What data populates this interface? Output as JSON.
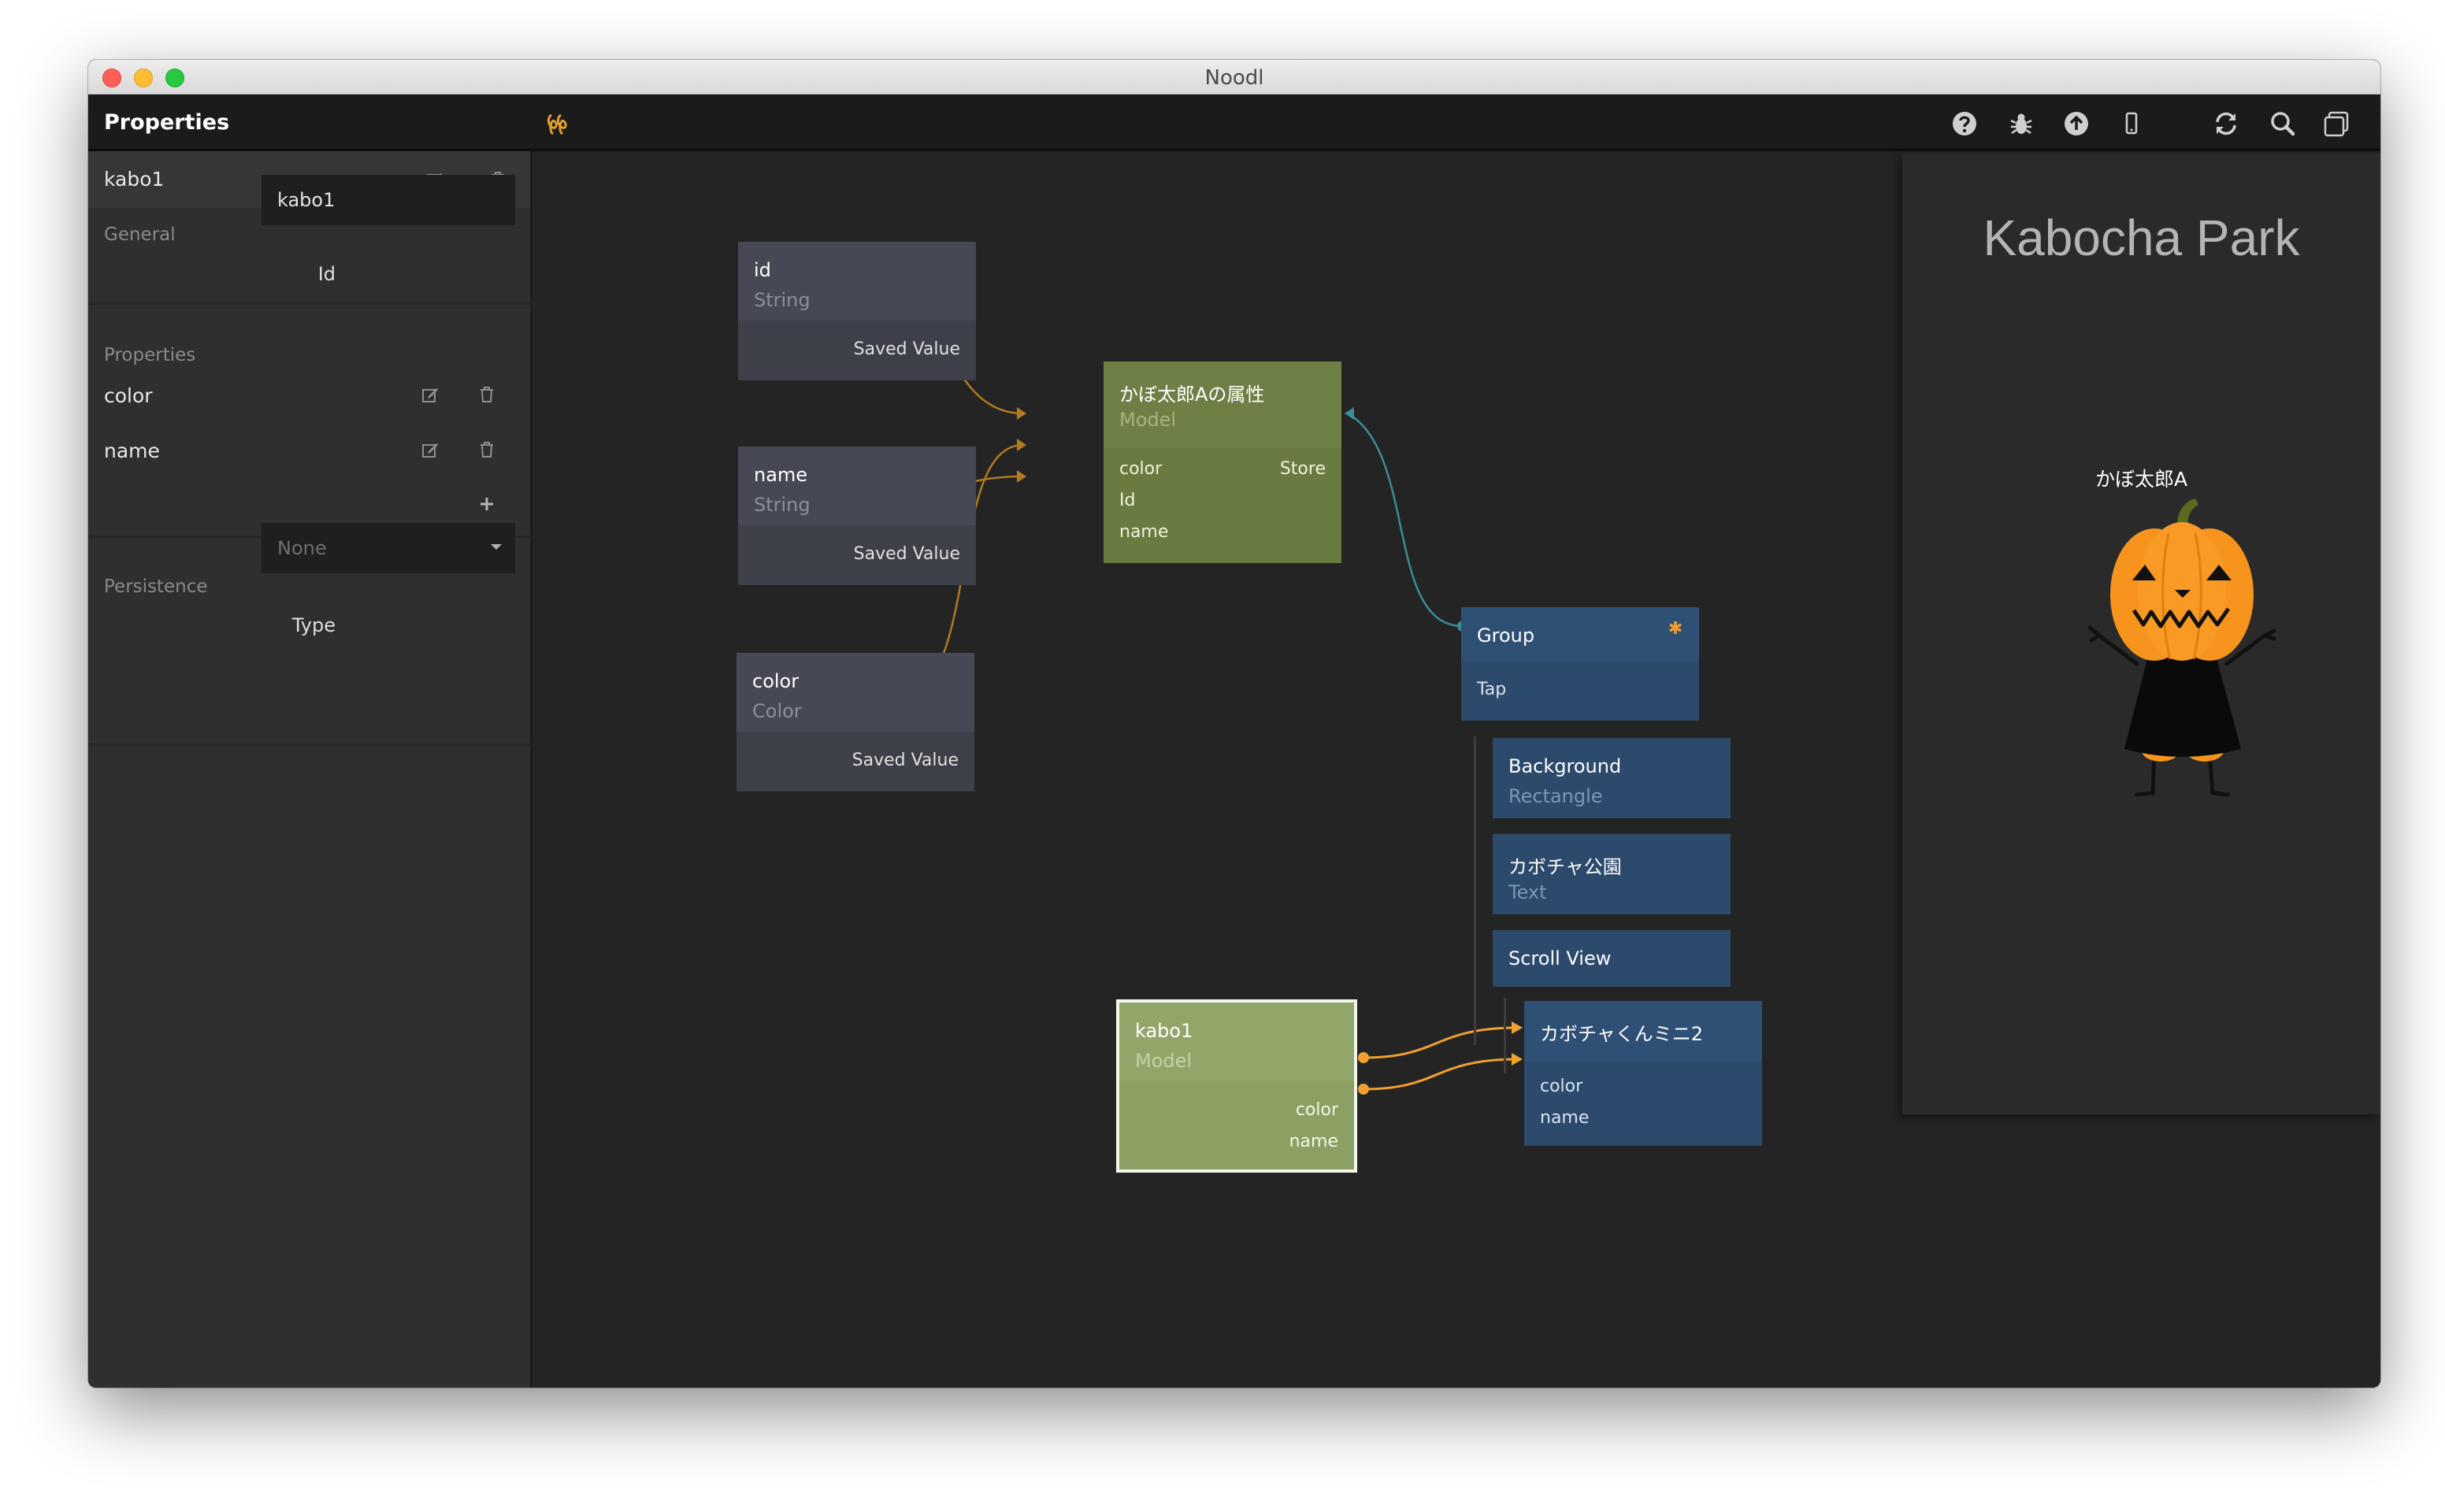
{
  "window": {
    "title": "Noodl"
  },
  "toolbar": {
    "panel_title": "Properties",
    "icons": [
      "help-icon",
      "bug-icon",
      "upload-icon",
      "mobile-preview-icon",
      "refresh-icon",
      "search-icon",
      "windows-icon"
    ],
    "accent_color": "#e0a030"
  },
  "left_panel": {
    "node_name": "kabo1",
    "general": {
      "label": "General",
      "id_label": "Id",
      "id_value": "kabo1"
    },
    "properties": {
      "label": "Properties",
      "items": [
        "color",
        "name"
      ]
    },
    "persistence": {
      "label": "Persistence",
      "type_label": "Type",
      "type_value": "None"
    }
  },
  "canvas": {
    "nodes": {
      "id_var": {
        "title": "id",
        "type": "String",
        "port": "Saved Value"
      },
      "name_var": {
        "title": "name",
        "type": "String",
        "port": "Saved Value"
      },
      "color_var": {
        "title": "color",
        "type": "Color",
        "port": "Saved Value"
      },
      "model_attr": {
        "title": "かぼ太郎Aの属性",
        "type": "Model",
        "inputs": [
          "color",
          "Id",
          "name"
        ],
        "output": "Store"
      },
      "group": {
        "title": "Group",
        "port": "Tap"
      },
      "background": {
        "title": "Background",
        "type": "Rectangle"
      },
      "park_text": {
        "title": "カボチャ公園",
        "type": "Text"
      },
      "scroll_view": {
        "title": "Scroll View"
      },
      "mini": {
        "title": "カボチャくんミニ2",
        "inputs": [
          "color",
          "name"
        ]
      },
      "kabo1": {
        "title": "kabo1",
        "type": "Model",
        "outputs": [
          "color",
          "name"
        ]
      }
    }
  },
  "preview": {
    "title": "Kabocha Park",
    "character_name": "かぼ太郎A"
  }
}
